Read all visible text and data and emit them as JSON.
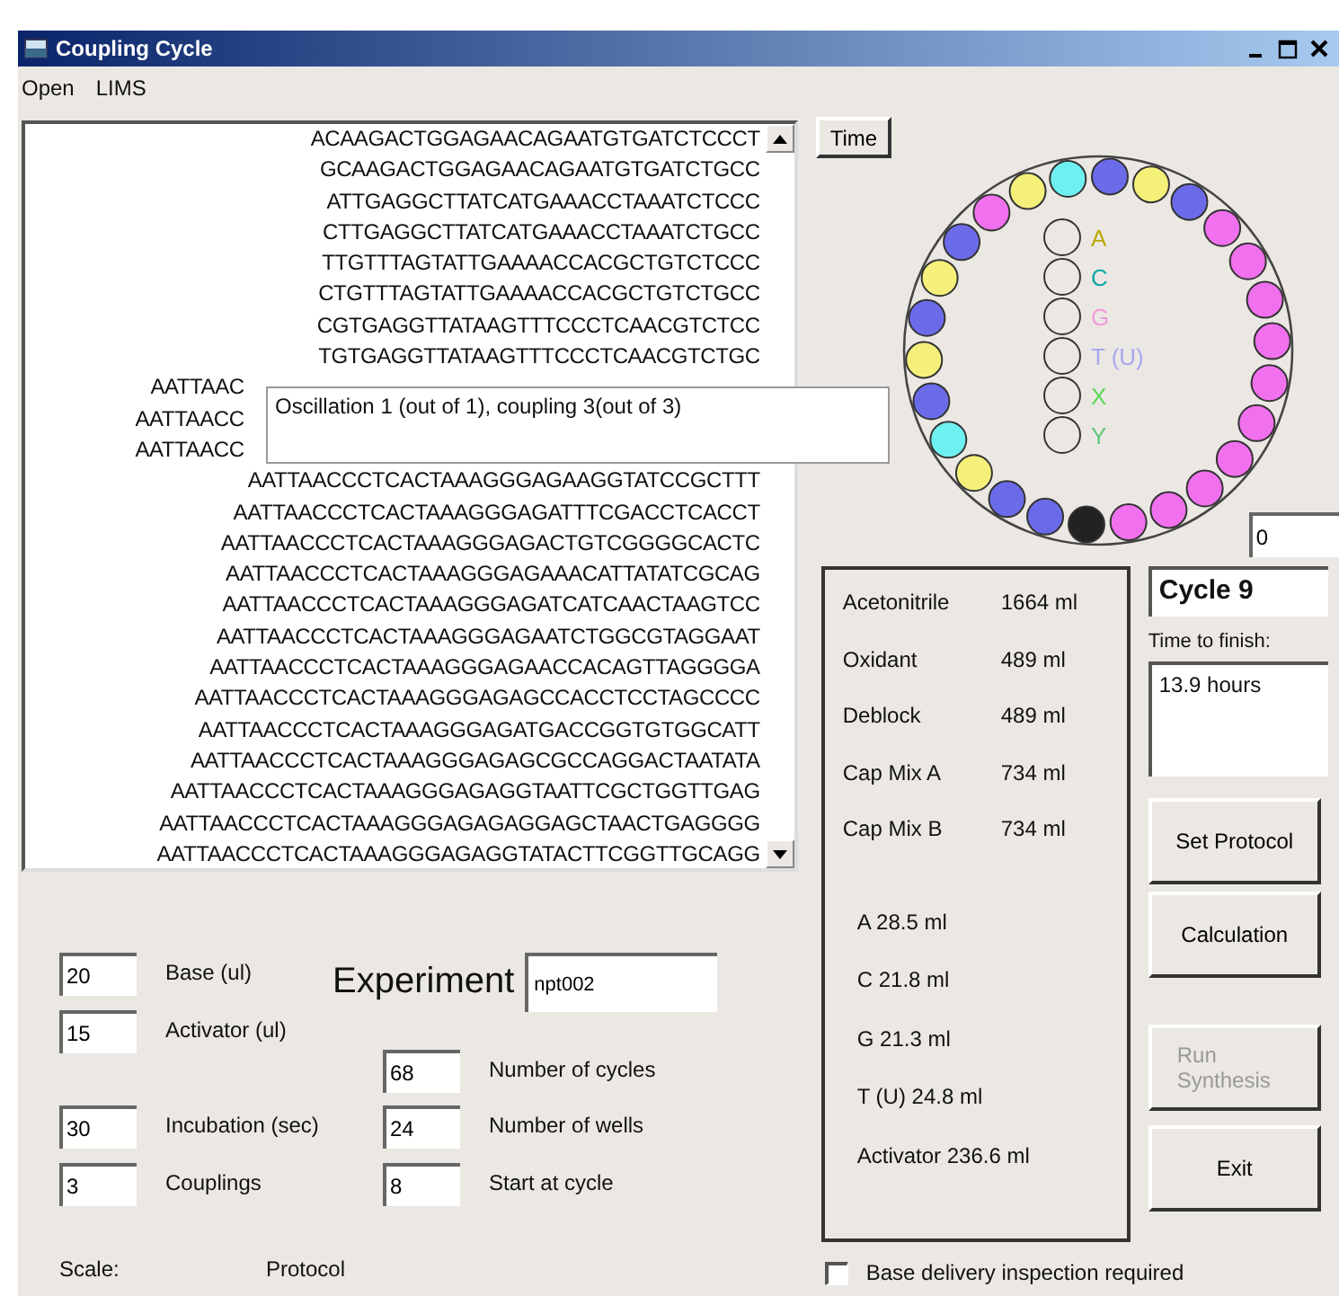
{
  "window": {
    "title": "Coupling Cycle"
  },
  "menu": [
    "Open",
    "LIMS"
  ],
  "sequences": [
    {
      "text": "ACAAGACTGGAGAACAGAATGTGATCTCCCT",
      "kind": "full"
    },
    {
      "text": "GCAAGACTGGAGAACAGAATGTGATCTGCC",
      "kind": "full"
    },
    {
      "text": "ATTGAGGCTTATCATGAAACCTAAATCTCCC",
      "kind": "full"
    },
    {
      "text": "CTTGAGGCTTATCATGAAACCTAAATCTGCC",
      "kind": "full"
    },
    {
      "text": "TTGTTTAGTATTGAAAACCACGCTGTCTCCC",
      "kind": "full"
    },
    {
      "text": "CTGTTTAGTATTGAAAACCACGCTGTCTGCC",
      "kind": "full"
    },
    {
      "text": "CGTGAGGTTATAAGTTTCCCTCAACGTCTCC",
      "kind": "full"
    },
    {
      "text": "TGTGAGGTTATAAGTTTCCCTCAACGTCTGC",
      "kind": "full"
    },
    {
      "text": "AATTAAC",
      "kind": "covered"
    },
    {
      "text": "AATTAACC",
      "kind": "covered"
    },
    {
      "text": "AATTAACC",
      "kind": "covered"
    },
    {
      "text": "AATTAACCCTCACTAAAGGGAGAAGGTATCCGCTTT",
      "kind": "full"
    },
    {
      "text": "AATTAACCCTCACTAAAGGGAGATTTCGACCTCACCT",
      "kind": "full"
    },
    {
      "text": "AATTAACCCTCACTAAAGGGAGACTGTCGGGGCACTC",
      "kind": "full"
    },
    {
      "text": "AATTAACCCTCACTAAAGGGAGAAACATTATATCGCAG",
      "kind": "full"
    },
    {
      "text": "AATTAACCCTCACTAAAGGGAGATCATCAACTAAGTCC",
      "kind": "full"
    },
    {
      "text": "AATTAACCCTCACTAAAGGGAGAATCTGGCGTAGGAAT",
      "kind": "full"
    },
    {
      "text": "AATTAACCCTCACTAAAGGGAGAACCACAGTTAGGGGA",
      "kind": "full"
    },
    {
      "text": "AATTAACCCTCACTAAAGGGAGAGCCACCTCCTAGCCCC",
      "kind": "full"
    },
    {
      "text": "AATTAACCCTCACTAAAGGGAGATGACCGGTGTGGCATT",
      "kind": "full"
    },
    {
      "text": "AATTAACCCTCACTAAAGGGAGAGCGCCAGGACTAATATA",
      "kind": "full"
    },
    {
      "text": "AATTAACCCTCACTAAAGGGAGAGGTAATTCGCTGGTTGAG",
      "kind": "full"
    },
    {
      "text": "AATTAACCCTCACTAAAGGGAGAGAGGAGCTAACTGAGGGG",
      "kind": "full"
    },
    {
      "text": "AATTAACCCTCACTAAAGGGAGAGGTATACTTCGGTTGCAGG",
      "kind": "full"
    }
  ],
  "tooltip": "Oscillation  1 (out of  1), coupling  3(out of  3)",
  "time_button": "Time",
  "wheel": {
    "wells": [
      {
        "color": "#6ff0f0"
      },
      {
        "color": "#6b6bea"
      },
      {
        "color": "#f5f07a"
      },
      {
        "color": "#6b6bea"
      },
      {
        "color": "#f070ee"
      },
      {
        "color": "#f070ee"
      },
      {
        "color": "#f070ee"
      },
      {
        "color": "#f070ee"
      },
      {
        "color": "#f070ee"
      },
      {
        "color": "#f070ee"
      },
      {
        "color": "#f070ee"
      },
      {
        "color": "#f070ee"
      },
      {
        "color": "#f070ee"
      },
      {
        "color": "#f070ee"
      },
      {
        "color": "#222222"
      },
      {
        "color": "#6b6bea"
      },
      {
        "color": "#6b6bea"
      },
      {
        "color": "#f5f07a"
      },
      {
        "color": "#6ff0f0"
      },
      {
        "color": "#6b6bea"
      },
      {
        "color": "#f5f07a"
      },
      {
        "color": "#6b6bea"
      },
      {
        "color": "#f5f07a"
      },
      {
        "color": "#6b6bea"
      },
      {
        "color": "#f070ee"
      },
      {
        "color": "#f5f07a"
      }
    ],
    "legend": [
      {
        "label": "A",
        "color": "#b8a800"
      },
      {
        "label": "C",
        "color": "#10a8a8"
      },
      {
        "label": "G",
        "color": "#f59ad8"
      },
      {
        "label": "T (U)",
        "color": "#a8a8f0"
      },
      {
        "label": "X",
        "color": "#5ad85a"
      },
      {
        "label": "Y",
        "color": "#5ac878"
      }
    ]
  },
  "well_field": {
    "value": "0"
  },
  "reagents": [
    {
      "name": "Acetonitrile",
      "amount": "1664 ml"
    },
    {
      "name": "Oxidant",
      "amount": "489 ml"
    },
    {
      "name": "Deblock",
      "amount": "489 ml"
    },
    {
      "name": "Cap Mix A",
      "amount": "734 ml"
    },
    {
      "name": "Cap Mix B",
      "amount": "734 ml"
    }
  ],
  "bases": [
    "A  28.5 ml",
    "C  21.8 ml",
    "G  21.3 ml",
    "T (U) 24.8 ml",
    "Activator  236.6 ml"
  ],
  "cycle": "Cycle 9",
  "time_label": "Time to finish:",
  "time_value": "13.9 hours",
  "buttons": [
    {
      "label": "Set Protocol",
      "disabled": false
    },
    {
      "label": "Calculation",
      "disabled": false
    },
    {
      "label": "Run Synthesis",
      "disabled": true
    },
    {
      "label": "Exit",
      "disabled": false
    }
  ],
  "inspection": {
    "label": "Base delivery inspection required",
    "checked": false
  },
  "experiment": {
    "label": "Experiment",
    "value": "npt002"
  },
  "left_parameters": [
    {
      "value": "20",
      "label": "Base (ul)"
    },
    {
      "value": "15",
      "label": "Activator (ul)"
    },
    {
      "value": "30",
      "label": "Incubation (sec)"
    },
    {
      "value": "3",
      "label": "Couplings"
    }
  ],
  "right_parameters": [
    {
      "value": "68",
      "label": "Number of cycles"
    },
    {
      "value": "24",
      "label": "Number of wells"
    },
    {
      "value": "8",
      "label": "Start at cycle"
    }
  ],
  "footer": [
    "Scale:",
    "Protocol"
  ]
}
